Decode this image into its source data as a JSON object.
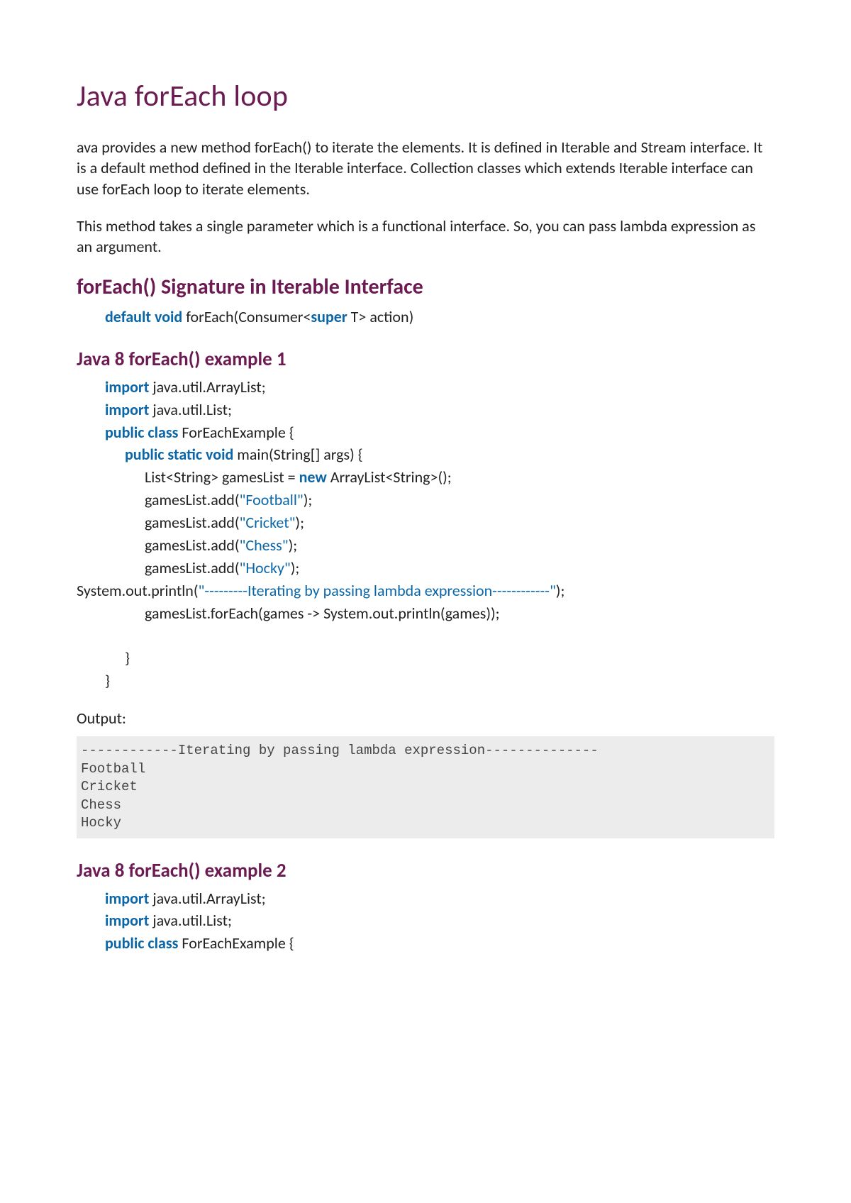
{
  "title": "Java forEach loop",
  "intro1": "ava provides a new method forEach() to iterate the elements. It is defined in Iterable and Stream interface. It is a default method defined in the Iterable interface. Collection classes which extends Iterable interface can use forEach loop to iterate elements.",
  "intro2": "This method takes a single parameter which is a functional interface. So, you can pass lambda expression as an argument.",
  "h2_signature": "forEach() Signature in Iterable Interface",
  "sig": {
    "kw1": "default void",
    "mid": " forEach(Consumer<",
    "kw2": "super",
    "tail": " T> action)"
  },
  "h3_ex1": "Java 8 forEach() example 1",
  "ex1": {
    "l1kw": "import",
    "l1txt": " java.util.ArrayList;",
    "l2kw": "import",
    "l2txt": " java.util.List;",
    "l3kw": "public class",
    "l3txt": " ForEachExample {",
    "l4kw": "public static void",
    "l4txt": " main(String[] args) {",
    "l5a": "List<String> gamesList = ",
    "l5kw": "new",
    "l5b": " ArrayList<String>();",
    "l6a": "gamesList.add(",
    "l6s": "\"Football\"",
    "l6b": ");",
    "l7a": "gamesList.add(",
    "l7s": "\"Cricket\"",
    "l7b": ");",
    "l8a": "gamesList.add(",
    "l8s": "\"Chess\"",
    "l8b": ");",
    "l9a": "gamesList.add(",
    "l9s": "\"Hocky\"",
    "l9b": ");",
    "l10a": "System.out.println(",
    "l10s": "\"---------Iterating by passing lambda expression------------\"",
    "l10b": ");",
    "l11": "gamesList.forEach(games -> System.out.println(games));",
    "l12": "}",
    "l13": "}"
  },
  "output_label": "Output:",
  "output_text": "------------Iterating by passing lambda expression--------------\nFootball\nCricket\nChess\nHocky",
  "h3_ex2": "Java 8 forEach() example 2",
  "ex2": {
    "l1kw": "import",
    "l1txt": " java.util.ArrayList;",
    "l2kw": "import",
    "l2txt": " java.util.List;",
    "l3kw": "public class",
    "l3txt": " ForEachExample {"
  }
}
